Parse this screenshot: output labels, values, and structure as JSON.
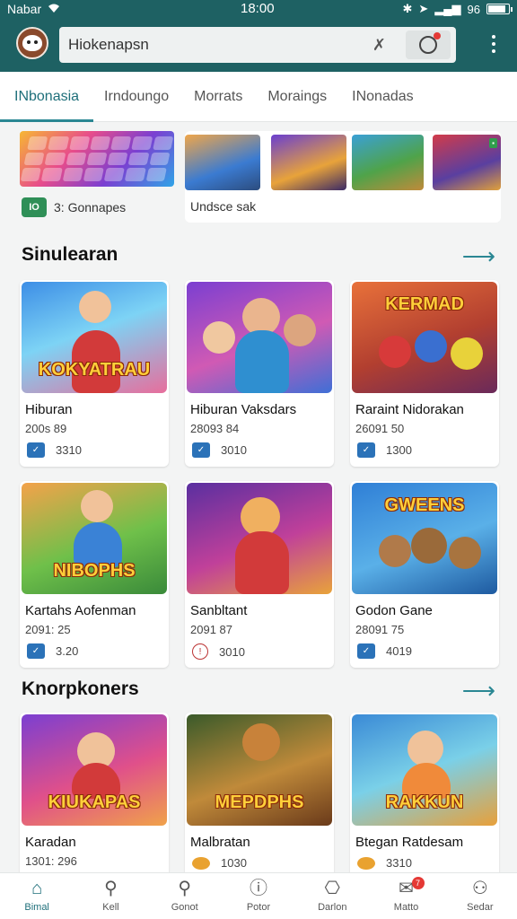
{
  "status_bar": {
    "carrier": "Nabar",
    "time": "18:00",
    "signal_text": "96"
  },
  "app_bar": {
    "search_value": "Hiokenapsn"
  },
  "tabs": [
    {
      "label": "INbonasia",
      "active": true
    },
    {
      "label": "Irndoungo",
      "active": false
    },
    {
      "label": "Morrats",
      "active": false
    },
    {
      "label": "Moraings",
      "active": false
    },
    {
      "label": "INonadas",
      "active": false
    }
  ],
  "featured": {
    "left_icon_text": "IO",
    "left_label": "3: Gonnapes",
    "right_label": "Undsce sak"
  },
  "sections": [
    {
      "title": "Sinulearan",
      "cards": [
        {
          "art_text": "KOKYATRAU",
          "name": "Hiburan",
          "sub": "200s 89",
          "stat": "3310"
        },
        {
          "art_text": "",
          "name": "Hiburan Vaksdars",
          "sub": "28093 84",
          "stat": "3010"
        },
        {
          "art_text": "KERMAD",
          "name": "Raraint Nidorakan",
          "sub": "26091 50",
          "stat": "1300"
        }
      ]
    },
    {
      "title": "",
      "cards": [
        {
          "art_text": "NIBOPHS",
          "name": "Kartahs Aofenman",
          "sub": "2091: 25",
          "stat": "3.20"
        },
        {
          "art_text": "",
          "name": "Sanbltant",
          "sub": "2091 87",
          "stat": "3010"
        },
        {
          "art_text": "GWEENS",
          "name": "Godon Gane",
          "sub": "28091 75",
          "stat": "4019"
        }
      ]
    },
    {
      "title": "Knorpkoners",
      "cards": [
        {
          "art_text": "KIUKAPAS",
          "name": "Karadan",
          "sub": "1301: 296",
          "stat": ""
        },
        {
          "art_text": "MEPDPHS",
          "name": "Malbratan",
          "sub": "",
          "stat": "1030"
        },
        {
          "art_text": "RAKKUN",
          "name": "Btegan Ratdesam",
          "sub": "",
          "stat": "3310"
        }
      ]
    }
  ],
  "bottom_nav": [
    {
      "label": "Bimal",
      "icon": "home-icon",
      "active": true
    },
    {
      "label": "Kell",
      "icon": "search-icon",
      "active": false
    },
    {
      "label": "Gonot",
      "icon": "search-alt-icon",
      "active": false
    },
    {
      "label": "Potor",
      "icon": "info-icon",
      "active": false
    },
    {
      "label": "Darlon",
      "icon": "controller-icon",
      "active": false
    },
    {
      "label": "Matto",
      "icon": "mail-icon",
      "active": false,
      "badge": "7"
    },
    {
      "label": "Sedar",
      "icon": "person-icon",
      "active": false
    }
  ]
}
